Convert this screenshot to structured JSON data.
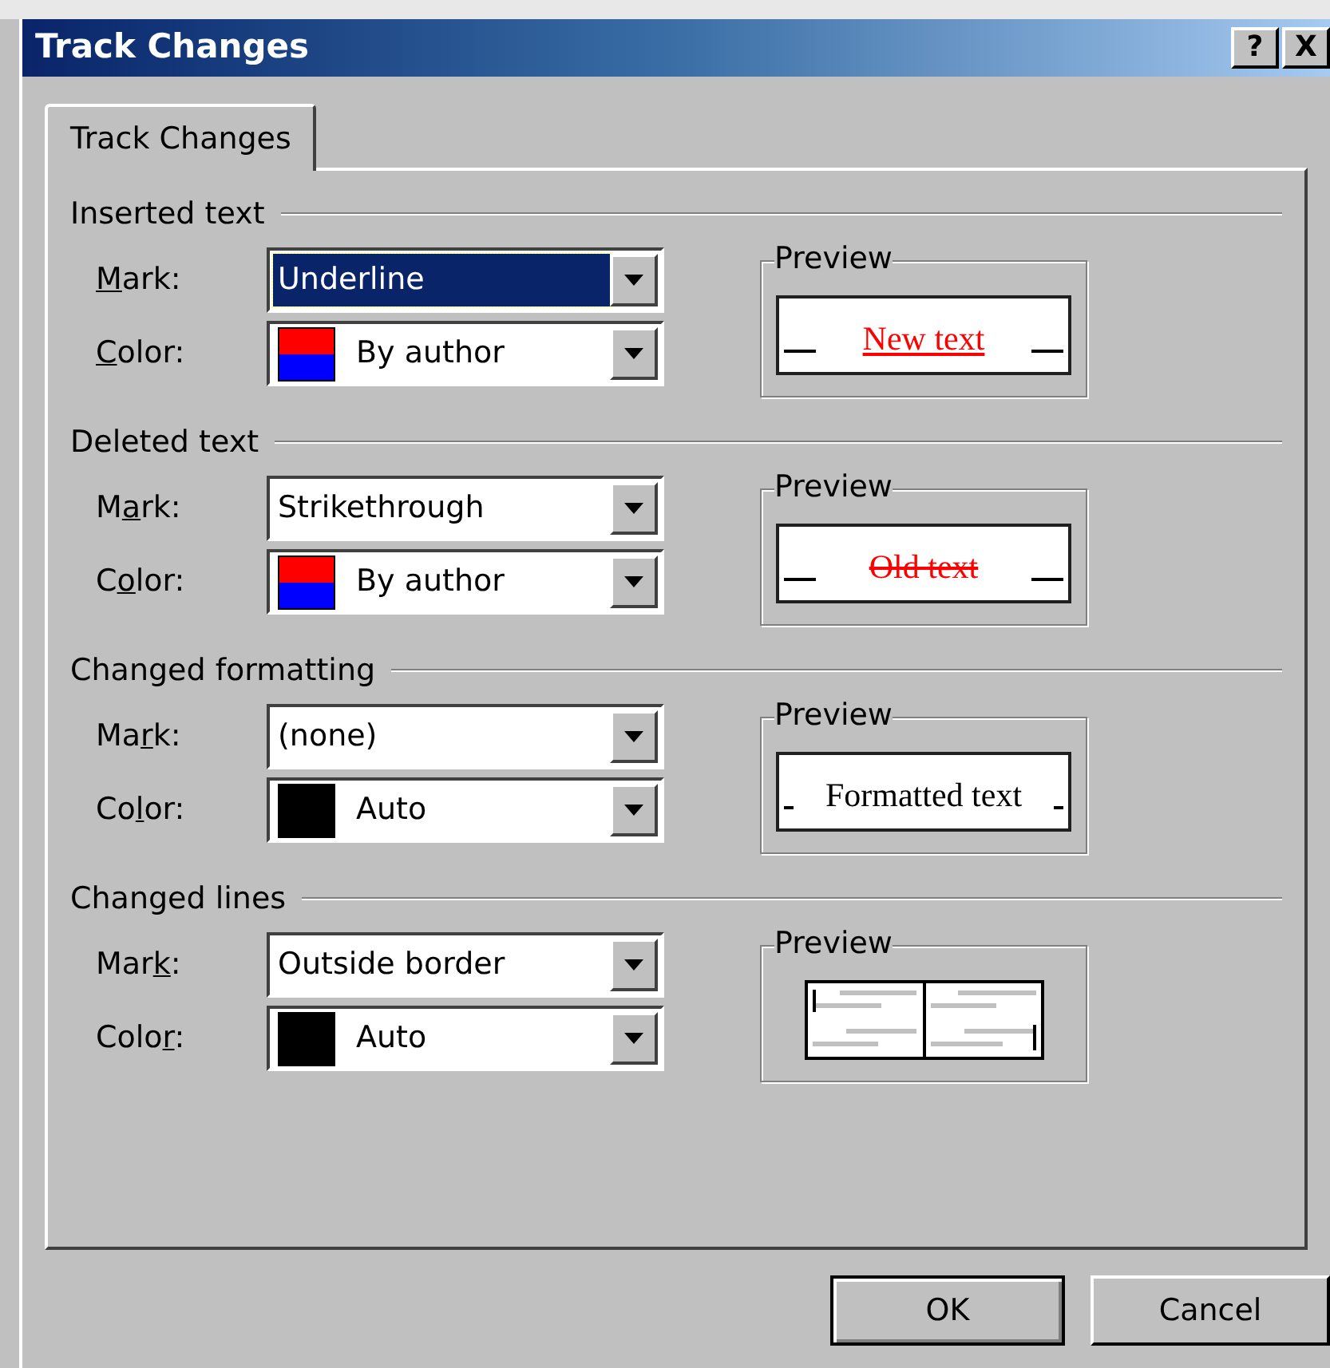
{
  "window": {
    "title": "Track Changes",
    "title_buttons": [
      "?",
      "X"
    ]
  },
  "tabs": [
    {
      "label": "Track Changes",
      "selected": true
    }
  ],
  "sections": [
    {
      "heading": "Inserted text",
      "rows": [
        {
          "kind": "mark",
          "label": [
            {
              "text": "M",
              "underline": true
            },
            {
              "text": "ark:",
              "underline": false
            }
          ],
          "value": "Underline",
          "focused": true
        },
        {
          "kind": "color",
          "label": [
            {
              "text": "C",
              "underline": true
            },
            {
              "text": "olor:",
              "underline": false
            }
          ],
          "value": "By author",
          "by_author": true,
          "focused": false
        }
      ],
      "preview": {
        "title": "Preview",
        "kind": "underline",
        "text": "New text"
      }
    },
    {
      "heading": "Deleted text",
      "rows": [
        {
          "kind": "mark",
          "label": [
            {
              "text": "M",
              "underline": false
            },
            {
              "text": "a",
              "underline": true
            },
            {
              "text": "rk:",
              "underline": false
            }
          ],
          "value": "Strikethrough",
          "focused": false
        },
        {
          "kind": "color",
          "label": [
            {
              "text": "C",
              "underline": false
            },
            {
              "text": "o",
              "underline": true
            },
            {
              "text": "lor:",
              "underline": false
            }
          ],
          "value": "By author",
          "by_author": true,
          "focused": false
        }
      ],
      "preview": {
        "title": "Preview",
        "kind": "strikethrough",
        "text": "Old text"
      }
    },
    {
      "heading": "Changed formatting",
      "rows": [
        {
          "kind": "mark",
          "label": [
            {
              "text": "Ma",
              "underline": false
            },
            {
              "text": "r",
              "underline": true
            },
            {
              "text": "k:",
              "underline": false
            }
          ],
          "value": "(none)",
          "focused": false
        },
        {
          "kind": "color",
          "label": [
            {
              "text": "Co",
              "underline": false
            },
            {
              "text": "l",
              "underline": true
            },
            {
              "text": "or:",
              "underline": false
            }
          ],
          "value": "Auto",
          "by_author": false,
          "focused": false
        }
      ],
      "preview": {
        "title": "Preview",
        "kind": "formatted",
        "text": "Formatted text"
      }
    },
    {
      "heading": "Changed lines",
      "rows": [
        {
          "kind": "mark",
          "label": [
            {
              "text": "Mar",
              "underline": false
            },
            {
              "text": "k",
              "underline": true
            },
            {
              "text": ":",
              "underline": false
            }
          ],
          "value": "Outside border",
          "focused": false
        },
        {
          "kind": "color",
          "label": [
            {
              "text": "Colo",
              "underline": false
            },
            {
              "text": "r",
              "underline": true
            },
            {
              "text": ":",
              "underline": false
            }
          ],
          "value": "Auto",
          "by_author": false,
          "focused": false
        }
      ],
      "preview": {
        "title": "Preview",
        "kind": "lines"
      }
    }
  ],
  "buttons": [
    "OK",
    "Cancel"
  ]
}
